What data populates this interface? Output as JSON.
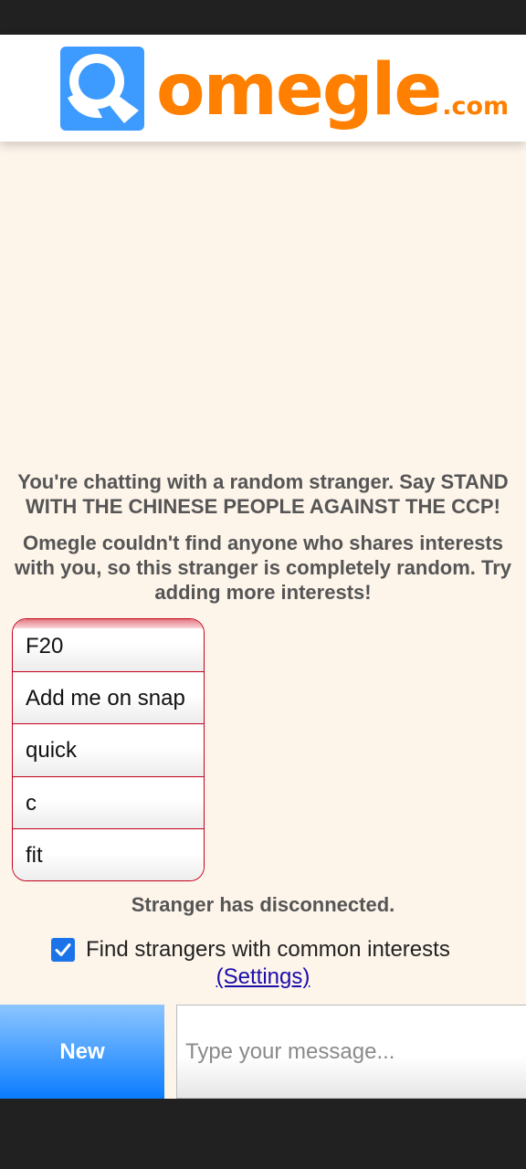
{
  "header": {
    "logo_name": "omegle",
    "logo_suffix": ".com",
    "colors": {
      "logo_orange": "#ff8000",
      "logo_blue": "#3399ff"
    }
  },
  "chat": {
    "intro_message": "You're chatting with a random stranger. Say STAND WITH THE CHINESE PEOPLE AGAINST THE CCP!",
    "interest_notice": "Omegle couldn't find anyone who shares interests with you, so this stranger is completely random. Try adding more interests!",
    "interests": [
      "F20",
      "Add me on snap",
      "quick",
      "c",
      "fit"
    ],
    "status": "Stranger has disconnected."
  },
  "options": {
    "common_interests_label": "Find strangers with common interests",
    "common_interests_checked": true,
    "settings_link": "(Settings)"
  },
  "composer": {
    "new_button": "New",
    "message_placeholder": "Type your message..."
  },
  "colors": {
    "accent_blue": "#0a7cff",
    "list_border": "#c4001a",
    "background": "#fdf4ea"
  }
}
